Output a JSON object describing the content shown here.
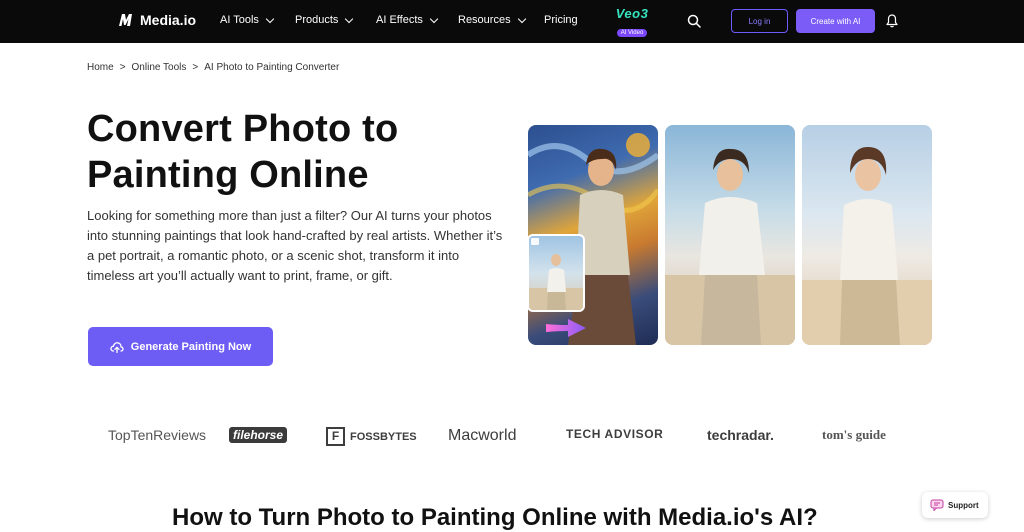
{
  "nav": {
    "brand": "Media.io",
    "items": [
      {
        "label": "AI Tools",
        "dropdown": true
      },
      {
        "label": "Products",
        "dropdown": true
      },
      {
        "label": "AI Effects",
        "dropdown": true
      },
      {
        "label": "Resources",
        "dropdown": true
      },
      {
        "label": "Pricing",
        "dropdown": false
      }
    ],
    "promo_title": "Veo3",
    "promo_badge": "AI Video",
    "login_label": "Log in",
    "create_label": "Create with AI"
  },
  "breadcrumb": {
    "items": [
      "Home",
      "Online Tools",
      "AI Photo to Painting Converter"
    ],
    "separator": ">"
  },
  "hero": {
    "title_line1": "Convert Photo to",
    "title_line2": "Painting Online",
    "description": "Looking for something more than just a filter? Our AI turns your photos into stunning paintings that look hand-crafted by real artists. Whether it’s a pet portrait, a romantic photo, or a scenic shot, transform it into timeless art you’ll actually want to print, frame, or gift.",
    "cta_label": "Generate Painting Now"
  },
  "press_logos": [
    "TopTenReviews",
    "filehorse",
    "FOSSBYTES",
    "Macworld",
    "TECH ADVISOR",
    "techradar.",
    "tom's guide"
  ],
  "section": {
    "title": "How to Turn Photo to Painting Online with Media.io's AI?"
  },
  "support_label": "Support",
  "colors": {
    "accent": "#6d5df5",
    "topbar": "#0a0a0a",
    "promo": "#36e3c0"
  }
}
